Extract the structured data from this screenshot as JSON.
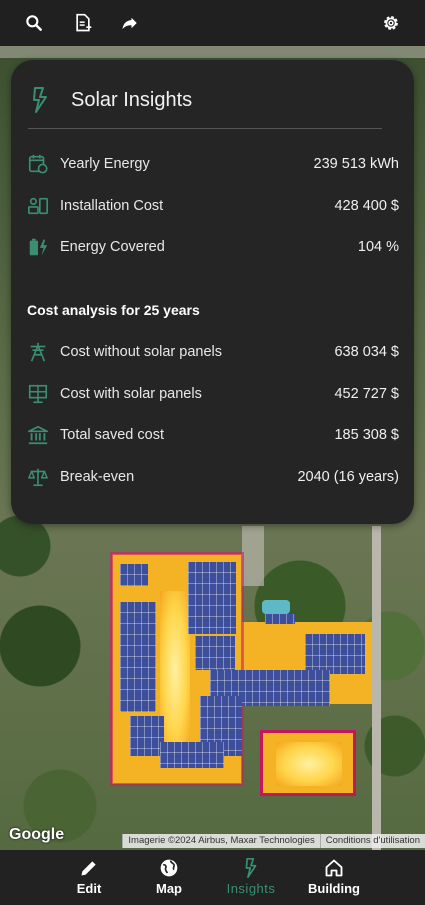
{
  "toolbar": {
    "icons": [
      "search-icon",
      "note-add-icon",
      "share-icon",
      "settings-icon"
    ]
  },
  "card": {
    "title": "Solar Insights",
    "rows": [
      {
        "icon": "calendar-energy-icon",
        "label": "Yearly Energy",
        "value": "239 513 kWh"
      },
      {
        "icon": "installation-cost-icon",
        "label": "Installation Cost",
        "value": "428 400 $"
      },
      {
        "icon": "battery-charging-icon",
        "label": "Energy Covered",
        "value": "104 %"
      }
    ],
    "section_title": "Cost analysis for 25 years",
    "cost_rows": [
      {
        "icon": "power-tower-icon",
        "label": "Cost without solar panels",
        "value": "638 034 $"
      },
      {
        "icon": "solar-panel-icon",
        "label": "Cost with solar panels",
        "value": "452 727 $"
      },
      {
        "icon": "bank-icon",
        "label": "Total saved cost",
        "value": "185 308 $"
      },
      {
        "icon": "balance-scale-icon",
        "label": "Break-even",
        "value": "2040 (16 years)"
      }
    ]
  },
  "map": {
    "logo": "Google",
    "attribution": "Imagerie ©2024 Airbus, Maxar Technologies",
    "terms": "Conditions d'utilisation"
  },
  "nav": {
    "items": [
      {
        "icon": "edit-icon",
        "label": "Edit"
      },
      {
        "icon": "globe-icon",
        "label": "Map"
      },
      {
        "icon": "bolt-icon",
        "label": "Insights"
      },
      {
        "icon": "home-icon",
        "label": "Building"
      }
    ],
    "active": "Insights"
  },
  "colors": {
    "accent": "#3a8f72",
    "card_bg": "#252525",
    "bar_bg": "#202020"
  }
}
